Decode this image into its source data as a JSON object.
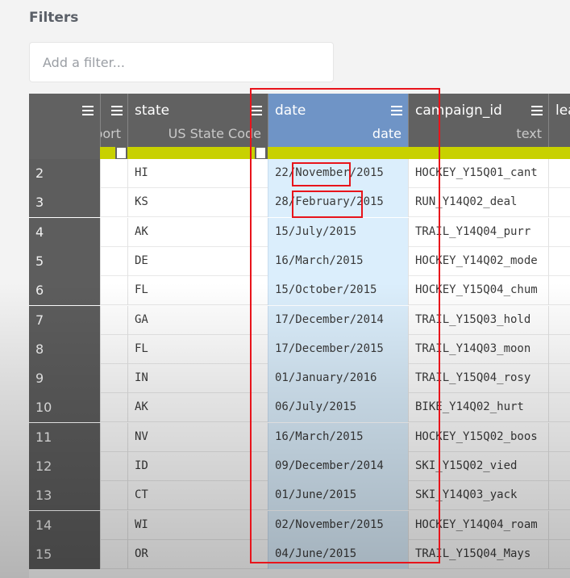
{
  "filters": {
    "title": "Filters",
    "placeholder": "Add a filter..."
  },
  "columns": {
    "import": {
      "name": "",
      "meaning": "port"
    },
    "state": {
      "name": "state",
      "meaning": "US State Code"
    },
    "date": {
      "name": "date",
      "meaning": "date"
    },
    "campaign_id": {
      "name": "campaign_id",
      "meaning": "text"
    },
    "lead": {
      "name": "lea",
      "meaning": ""
    }
  },
  "rows": [
    {
      "idx": "2",
      "state": "HI",
      "date": "22/November/2015",
      "campaign": "HOCKEY_Y15Q01_cant"
    },
    {
      "idx": "3",
      "state": "KS",
      "date": "28/February/2015",
      "campaign": "RUN_Y14Q02_deal"
    },
    {
      "idx": "4",
      "state": "AK",
      "date": "15/July/2015",
      "campaign": "TRAIL_Y14Q04_purr"
    },
    {
      "idx": "5",
      "state": "DE",
      "date": "16/March/2015",
      "campaign": "HOCKEY_Y14Q02_mode"
    },
    {
      "idx": "6",
      "state": "FL",
      "date": "15/October/2015",
      "campaign": "HOCKEY_Y15Q04_chum"
    },
    {
      "idx": "7",
      "state": "GA",
      "date": "17/December/2014",
      "campaign": "TRAIL_Y15Q03_hold"
    },
    {
      "idx": "8",
      "state": "FL",
      "date": "17/December/2015",
      "campaign": "TRAIL_Y14Q03_moon"
    },
    {
      "idx": "9",
      "state": "IN",
      "date": "01/January/2016",
      "campaign": "TRAIL_Y15Q04_rosy"
    },
    {
      "idx": "10",
      "state": "AK",
      "date": "06/July/2015",
      "campaign": "BIKE_Y14Q02_hurt"
    },
    {
      "idx": "11",
      "state": "NV",
      "date": "16/March/2015",
      "campaign": "HOCKEY_Y15Q02_boos"
    },
    {
      "idx": "12",
      "state": "ID",
      "date": "09/December/2014",
      "campaign": "SKI_Y15Q02_vied"
    },
    {
      "idx": "13",
      "state": "CT",
      "date": "01/June/2015",
      "campaign": "SKI_Y14Q03_yack"
    },
    {
      "idx": "14",
      "state": "WI",
      "date": "02/November/2015",
      "campaign": "HOCKEY_Y14Q04_roam"
    },
    {
      "idx": "15",
      "state": "OR",
      "date": "04/June/2015",
      "campaign": "TRAIL_Y15Q04_Mays"
    }
  ],
  "colors": {
    "header_bg": "#616161",
    "selected_column": "#6f94c6",
    "selected_cells": "#dbeefc",
    "quality_ok": "#c8d100",
    "annotation": "#e8141b"
  }
}
